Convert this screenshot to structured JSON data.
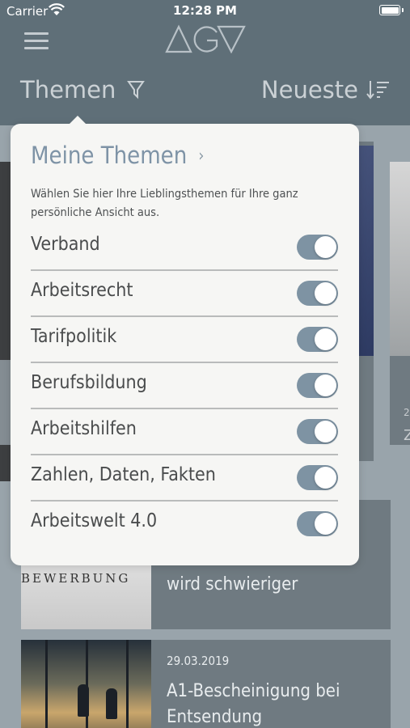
{
  "status_bar": {
    "carrier": "Carrier",
    "time": "12:28 PM"
  },
  "header": {
    "topics_label": "Themen",
    "sort_label": "Neueste"
  },
  "popover": {
    "title": "Meine Themen",
    "chevron": "›",
    "description": "Wählen Sie hier Ihre Lieblingsthemen für Ihre ganz persönliche Ansicht aus.",
    "topics": [
      {
        "label": "Verband",
        "enabled": true
      },
      {
        "label": "Arbeitsrecht",
        "enabled": true
      },
      {
        "label": "Tarifpolitik",
        "enabled": true
      },
      {
        "label": "Berufsbildung",
        "enabled": true
      },
      {
        "label": "Arbeitshilfen",
        "enabled": true
      },
      {
        "label": "Zahlen, Daten, Fakten",
        "enabled": true
      },
      {
        "label": "Arbeitswelt 4.0",
        "enabled": true
      }
    ]
  },
  "feed": {
    "right_card": {
      "date": "2",
      "title": "Z"
    },
    "card_bewerbung": {
      "image_text": "BEWERBUNG",
      "title": "wird schwieriger"
    },
    "card_a1": {
      "date": "29.03.2019",
      "title_line1": "A1-Bescheinigung bei",
      "title_line2": "Entsendung"
    }
  },
  "icons": {
    "menu": "hamburger-icon",
    "logo": "agv-logo",
    "filter": "filter-icon",
    "sort": "sort-descending-icon"
  },
  "colors": {
    "header_bg": "#5f6f78",
    "accent": "#7e93a6",
    "toggle_on": "#7e93a3"
  }
}
